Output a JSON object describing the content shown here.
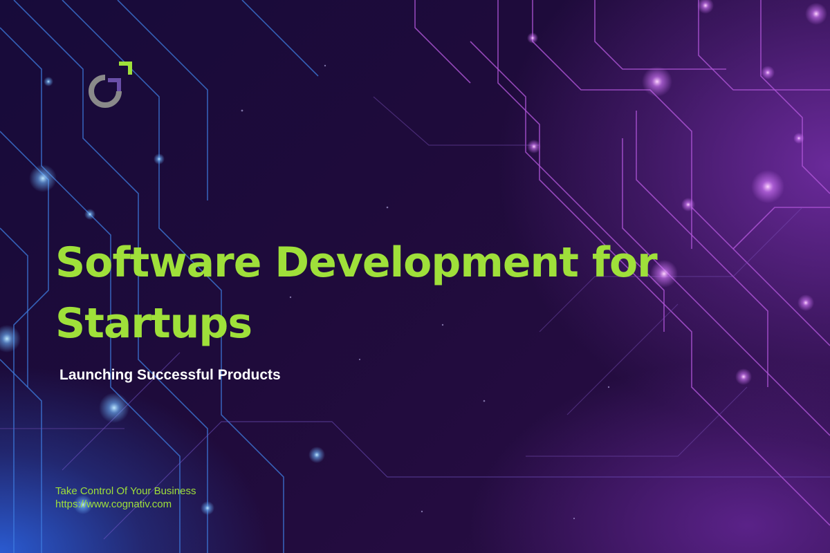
{
  "brand": {
    "logo": "cognativ-logo",
    "accent_color": "#9fe03a",
    "secondary_color": "#6a4fa8"
  },
  "headline": {
    "line1": "Software Development for",
    "line2": "Startups"
  },
  "subtitle": "Launching Successful Products",
  "footer": {
    "tagline": "Take Control Of Your Business",
    "url": "https://www.cognativ.com"
  },
  "colors": {
    "background_dark": "#1f0b3b",
    "glow_blue": "#2a5bd1",
    "glow_purple": "#6a2a9a",
    "headline": "#9fe03a",
    "subtitle": "#ffffff"
  }
}
